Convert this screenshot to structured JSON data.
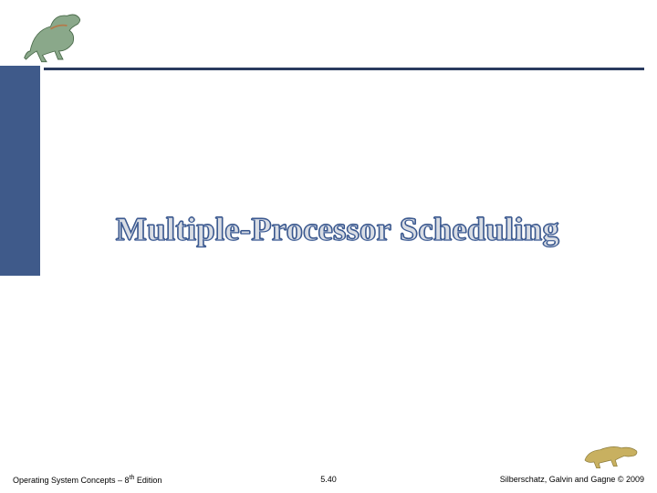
{
  "title": "Multiple-Processor Scheduling",
  "footer": {
    "left_prefix": "Operating System Concepts – 8",
    "left_sup": "th",
    "left_suffix": " Edition",
    "center": "5.40",
    "right": "Silberschatz, Galvin and Gagne © 2009"
  },
  "icons": {
    "top_dino": "dinosaur-running-icon",
    "bottom_dino": "dinosaur-crouching-icon"
  },
  "colors": {
    "accent": "#3f5a8a",
    "rule": "#2a3b5f",
    "title_stroke": "#3b5a93"
  }
}
